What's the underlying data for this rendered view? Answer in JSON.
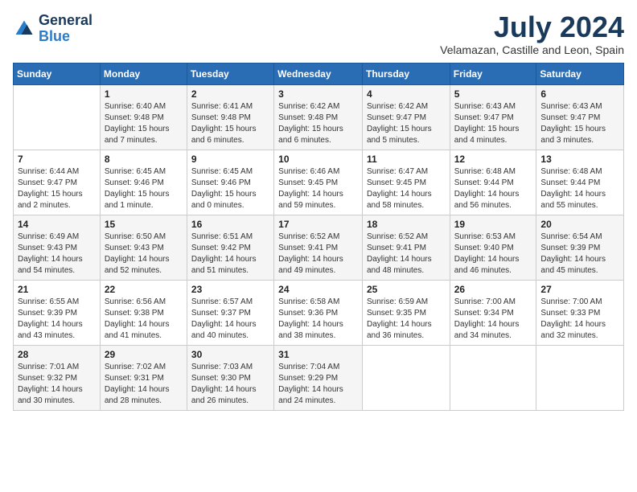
{
  "logo": {
    "line1": "General",
    "line2": "Blue"
  },
  "title": "July 2024",
  "location": "Velamazan, Castille and Leon, Spain",
  "weekdays": [
    "Sunday",
    "Monday",
    "Tuesday",
    "Wednesday",
    "Thursday",
    "Friday",
    "Saturday"
  ],
  "weeks": [
    [
      {
        "day": "",
        "info": ""
      },
      {
        "day": "1",
        "info": "Sunrise: 6:40 AM\nSunset: 9:48 PM\nDaylight: 15 hours\nand 7 minutes."
      },
      {
        "day": "2",
        "info": "Sunrise: 6:41 AM\nSunset: 9:48 PM\nDaylight: 15 hours\nand 6 minutes."
      },
      {
        "day": "3",
        "info": "Sunrise: 6:42 AM\nSunset: 9:48 PM\nDaylight: 15 hours\nand 6 minutes."
      },
      {
        "day": "4",
        "info": "Sunrise: 6:42 AM\nSunset: 9:47 PM\nDaylight: 15 hours\nand 5 minutes."
      },
      {
        "day": "5",
        "info": "Sunrise: 6:43 AM\nSunset: 9:47 PM\nDaylight: 15 hours\nand 4 minutes."
      },
      {
        "day": "6",
        "info": "Sunrise: 6:43 AM\nSunset: 9:47 PM\nDaylight: 15 hours\nand 3 minutes."
      }
    ],
    [
      {
        "day": "7",
        "info": "Sunrise: 6:44 AM\nSunset: 9:47 PM\nDaylight: 15 hours\nand 2 minutes."
      },
      {
        "day": "8",
        "info": "Sunrise: 6:45 AM\nSunset: 9:46 PM\nDaylight: 15 hours\nand 1 minute."
      },
      {
        "day": "9",
        "info": "Sunrise: 6:45 AM\nSunset: 9:46 PM\nDaylight: 15 hours\nand 0 minutes."
      },
      {
        "day": "10",
        "info": "Sunrise: 6:46 AM\nSunset: 9:45 PM\nDaylight: 14 hours\nand 59 minutes."
      },
      {
        "day": "11",
        "info": "Sunrise: 6:47 AM\nSunset: 9:45 PM\nDaylight: 14 hours\nand 58 minutes."
      },
      {
        "day": "12",
        "info": "Sunrise: 6:48 AM\nSunset: 9:44 PM\nDaylight: 14 hours\nand 56 minutes."
      },
      {
        "day": "13",
        "info": "Sunrise: 6:48 AM\nSunset: 9:44 PM\nDaylight: 14 hours\nand 55 minutes."
      }
    ],
    [
      {
        "day": "14",
        "info": "Sunrise: 6:49 AM\nSunset: 9:43 PM\nDaylight: 14 hours\nand 54 minutes."
      },
      {
        "day": "15",
        "info": "Sunrise: 6:50 AM\nSunset: 9:43 PM\nDaylight: 14 hours\nand 52 minutes."
      },
      {
        "day": "16",
        "info": "Sunrise: 6:51 AM\nSunset: 9:42 PM\nDaylight: 14 hours\nand 51 minutes."
      },
      {
        "day": "17",
        "info": "Sunrise: 6:52 AM\nSunset: 9:41 PM\nDaylight: 14 hours\nand 49 minutes."
      },
      {
        "day": "18",
        "info": "Sunrise: 6:52 AM\nSunset: 9:41 PM\nDaylight: 14 hours\nand 48 minutes."
      },
      {
        "day": "19",
        "info": "Sunrise: 6:53 AM\nSunset: 9:40 PM\nDaylight: 14 hours\nand 46 minutes."
      },
      {
        "day": "20",
        "info": "Sunrise: 6:54 AM\nSunset: 9:39 PM\nDaylight: 14 hours\nand 45 minutes."
      }
    ],
    [
      {
        "day": "21",
        "info": "Sunrise: 6:55 AM\nSunset: 9:39 PM\nDaylight: 14 hours\nand 43 minutes."
      },
      {
        "day": "22",
        "info": "Sunrise: 6:56 AM\nSunset: 9:38 PM\nDaylight: 14 hours\nand 41 minutes."
      },
      {
        "day": "23",
        "info": "Sunrise: 6:57 AM\nSunset: 9:37 PM\nDaylight: 14 hours\nand 40 minutes."
      },
      {
        "day": "24",
        "info": "Sunrise: 6:58 AM\nSunset: 9:36 PM\nDaylight: 14 hours\nand 38 minutes."
      },
      {
        "day": "25",
        "info": "Sunrise: 6:59 AM\nSunset: 9:35 PM\nDaylight: 14 hours\nand 36 minutes."
      },
      {
        "day": "26",
        "info": "Sunrise: 7:00 AM\nSunset: 9:34 PM\nDaylight: 14 hours\nand 34 minutes."
      },
      {
        "day": "27",
        "info": "Sunrise: 7:00 AM\nSunset: 9:33 PM\nDaylight: 14 hours\nand 32 minutes."
      }
    ],
    [
      {
        "day": "28",
        "info": "Sunrise: 7:01 AM\nSunset: 9:32 PM\nDaylight: 14 hours\nand 30 minutes."
      },
      {
        "day": "29",
        "info": "Sunrise: 7:02 AM\nSunset: 9:31 PM\nDaylight: 14 hours\nand 28 minutes."
      },
      {
        "day": "30",
        "info": "Sunrise: 7:03 AM\nSunset: 9:30 PM\nDaylight: 14 hours\nand 26 minutes."
      },
      {
        "day": "31",
        "info": "Sunrise: 7:04 AM\nSunset: 9:29 PM\nDaylight: 14 hours\nand 24 minutes."
      },
      {
        "day": "",
        "info": ""
      },
      {
        "day": "",
        "info": ""
      },
      {
        "day": "",
        "info": ""
      }
    ]
  ]
}
